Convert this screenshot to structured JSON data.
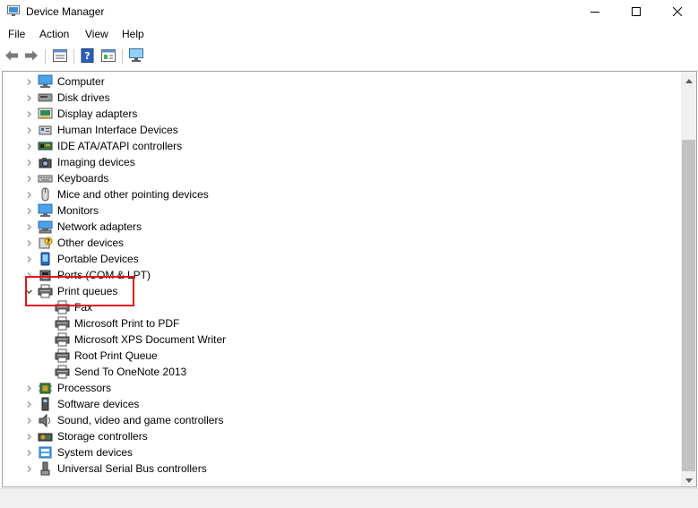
{
  "window": {
    "title": "Device Manager",
    "minimize_icon": "minimize-icon",
    "maximize_icon": "maximize-icon",
    "close_icon": "close-icon"
  },
  "menu": [
    "File",
    "Action",
    "View",
    "Help"
  ],
  "toolbar": {
    "buttons": [
      "back-arrow-icon",
      "forward-arrow-icon",
      "properties-icon",
      "help-icon",
      "show-hide-console-icon",
      "monitor-icon"
    ]
  },
  "colors": {
    "highlight_border": "#e0151d",
    "scrollbar_thumb": "#c2c2c2"
  },
  "tree": [
    {
      "label": "Computer",
      "icon": "computer-icon",
      "expanded": false
    },
    {
      "label": "Disk drives",
      "icon": "disk-drive-icon",
      "expanded": false
    },
    {
      "label": "Display adapters",
      "icon": "display-adapter-icon",
      "expanded": false
    },
    {
      "label": "Human Interface Devices",
      "icon": "hid-icon",
      "expanded": false
    },
    {
      "label": "IDE ATA/ATAPI controllers",
      "icon": "ide-controller-icon",
      "expanded": false
    },
    {
      "label": "Imaging devices",
      "icon": "camera-icon",
      "expanded": false
    },
    {
      "label": "Keyboards",
      "icon": "keyboard-icon",
      "expanded": false
    },
    {
      "label": "Mice and other pointing devices",
      "icon": "mouse-icon",
      "expanded": false
    },
    {
      "label": "Monitors",
      "icon": "monitor-icon",
      "expanded": false
    },
    {
      "label": "Network adapters",
      "icon": "network-adapter-icon",
      "expanded": false
    },
    {
      "label": "Other devices",
      "icon": "other-device-icon",
      "expanded": false
    },
    {
      "label": "Portable Devices",
      "icon": "portable-device-icon",
      "expanded": false
    },
    {
      "label": "Ports (COM & LPT)",
      "icon": "port-icon",
      "expanded": false
    },
    {
      "label": "Print queues",
      "icon": "printer-icon",
      "expanded": true
    },
    {
      "label": "Fax",
      "icon": "printer-icon",
      "child": true
    },
    {
      "label": "Microsoft Print to PDF",
      "icon": "printer-icon",
      "child": true
    },
    {
      "label": "Microsoft XPS Document Writer",
      "icon": "printer-icon",
      "child": true
    },
    {
      "label": "Root Print Queue",
      "icon": "printer-icon",
      "child": true
    },
    {
      "label": "Send To OneNote 2013",
      "icon": "printer-icon",
      "child": true
    },
    {
      "label": "Processors",
      "icon": "processor-icon",
      "expanded": false
    },
    {
      "label": "Software devices",
      "icon": "software-device-icon",
      "expanded": false
    },
    {
      "label": "Sound, video and game controllers",
      "icon": "speaker-icon",
      "expanded": false
    },
    {
      "label": "Storage controllers",
      "icon": "storage-controller-icon",
      "expanded": false
    },
    {
      "label": "System devices",
      "icon": "system-device-icon",
      "expanded": false
    },
    {
      "label": "Universal Serial Bus controllers",
      "icon": "usb-icon",
      "expanded": false
    }
  ]
}
